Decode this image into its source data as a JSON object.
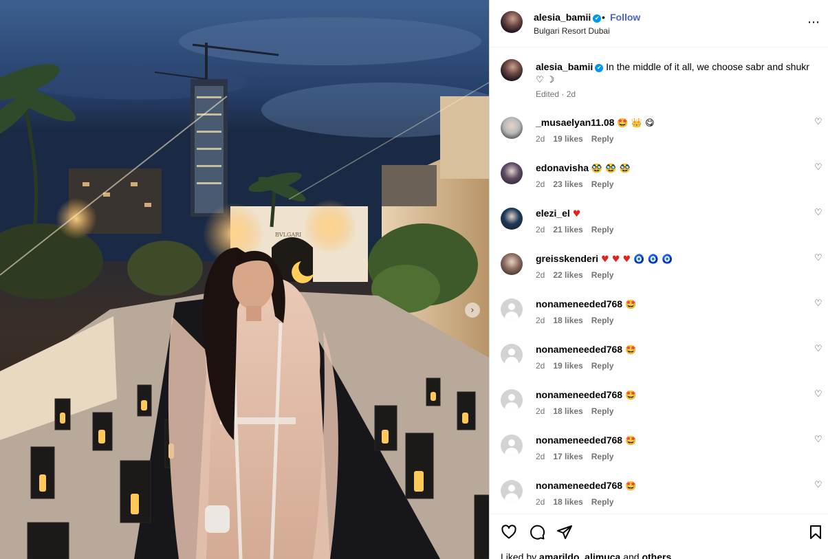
{
  "post": {
    "header": {
      "username": "alesia_bamii",
      "verified_icon": "✔",
      "separator": "•",
      "follow_label": "Follow",
      "location": "Bulgari Resort Dubai",
      "more_label": "⋯"
    },
    "caption": {
      "username": "alesia_bamii",
      "text": "In the middle of it all, we choose sabr and shukr",
      "emojis": "♡ ☽",
      "meta": "Edited · 2d"
    },
    "photo": {
      "sign_text": "BVLGARI",
      "next_icon": "›"
    },
    "comments": [
      {
        "username": "_musaelyan11.08",
        "text": "🤩 👑 😋",
        "time": "2d",
        "likes": "19 likes",
        "reply": "Reply",
        "avatar_color": "#b9b9b9"
      },
      {
        "username": "edonavisha",
        "text": "🥸 🥸 🥸",
        "time": "2d",
        "likes": "23 likes",
        "reply": "Reply",
        "avatar_color": "#5d4a66"
      },
      {
        "username": "elezi_el",
        "text": "♥",
        "time": "2d",
        "likes": "21 likes",
        "reply": "Reply",
        "avatar_color": "#1c3a5a"
      },
      {
        "username": "greisskenderi",
        "text": "♥ ♥ ♥ 🧿 🧿 🧿",
        "time": "2d",
        "likes": "22 likes",
        "reply": "Reply",
        "avatar_color": "#8a6a5c"
      },
      {
        "username": "nonameneeded768",
        "text": "🤩",
        "time": "2d",
        "likes": "18 likes",
        "reply": "Reply",
        "avatar_color": "ghost"
      },
      {
        "username": "nonameneeded768",
        "text": "🤩",
        "time": "2d",
        "likes": "19 likes",
        "reply": "Reply",
        "avatar_color": "ghost"
      },
      {
        "username": "nonameneeded768",
        "text": "🤩",
        "time": "2d",
        "likes": "18 likes",
        "reply": "Reply",
        "avatar_color": "ghost"
      },
      {
        "username": "nonameneeded768",
        "text": "🤩",
        "time": "2d",
        "likes": "17 likes",
        "reply": "Reply",
        "avatar_color": "ghost"
      },
      {
        "username": "nonameneeded768",
        "text": "🤩",
        "time": "2d",
        "likes": "18 likes",
        "reply": "Reply",
        "avatar_color": "ghost"
      }
    ],
    "comment_like_icon": "♡",
    "liked_by": {
      "prefix": "Liked by",
      "user": "amarildo_alimuca",
      "joiner": "and",
      "others": "others"
    }
  },
  "icons": {
    "like": "heart-icon",
    "comment": "comment-icon",
    "share": "share-icon",
    "save": "bookmark-icon"
  },
  "colors": {
    "follow": "#4c5fd7",
    "verified": "#0095f6",
    "heart": "#e0241f"
  }
}
